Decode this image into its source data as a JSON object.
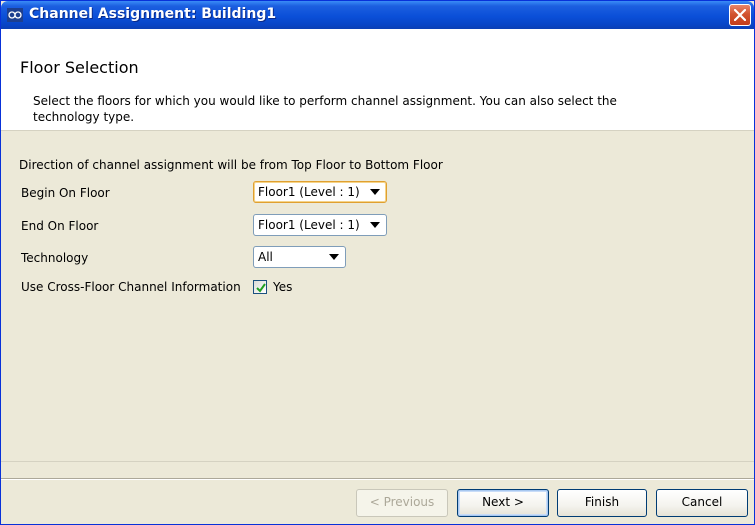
{
  "window": {
    "title": "Channel Assignment: Building1",
    "icon": "app-logo-icon",
    "close_icon": "close-icon"
  },
  "header": {
    "title": "Floor Selection",
    "description": "Select the floors for which you would like to perform channel assignment. You can also select the technology type."
  },
  "content": {
    "direction_text": "Direction of channel assignment will be from Top Floor to Bottom Floor",
    "begin_label": "Begin On Floor",
    "begin_value": "Floor1 (Level : 1)",
    "end_label": "End On Floor",
    "end_value": "Floor1 (Level : 1)",
    "technology_label": "Technology",
    "technology_value": "All",
    "crossfloor_label": "Use Cross-Floor Channel Information",
    "crossfloor_checked": true,
    "crossfloor_option": "Yes"
  },
  "buttons": {
    "previous": "< Previous",
    "next": "Next >",
    "finish": "Finish",
    "cancel": "Cancel"
  },
  "colors": {
    "titlebar": "#0a4fd8",
    "panel": "#ece9d8",
    "header_bg": "#ffffff",
    "close": "#d2532f",
    "check": "#21a121"
  }
}
